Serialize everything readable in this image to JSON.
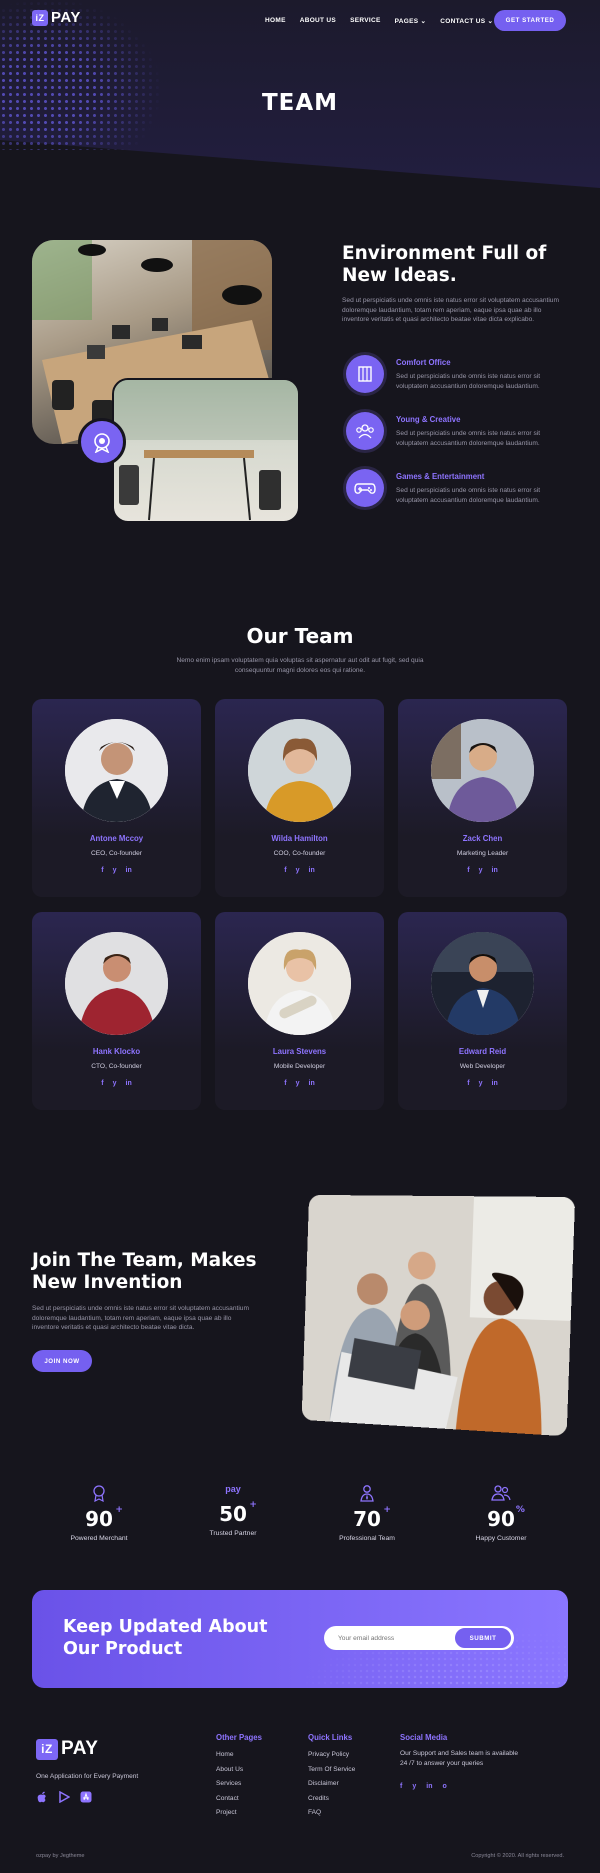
{
  "brand": {
    "logo_mark": "iZ",
    "logo_text": "PAY",
    "accent": "#7a64f2"
  },
  "nav": {
    "items": [
      "HOME",
      "ABOUT US",
      "SERVICE",
      "PAGES",
      "CONTACT US"
    ],
    "active": "PAGES",
    "cta": "GET STARTED"
  },
  "hero": {
    "title": "TEAM"
  },
  "environment": {
    "title_line1": "Environment Full of",
    "title_line2": "New Ideas.",
    "desc": "Sed ut perspiciatis unde omnis iste natus error sit voluptatem accusantium doloremque laudantium, totam rem aperiam, eaque ipsa quae ab illo inventore veritatis et quasi architecto beatae vitae dicta explicabo.",
    "features": [
      {
        "title": "Comfort Office",
        "desc": "Sed ut perspiciatis unde omnis iste natus error sit voluptatem accusantium doloremque laudantium.",
        "icon": "building-icon"
      },
      {
        "title": "Young & Creative",
        "desc": "Sed ut perspiciatis unde omnis iste natus error sit voluptatem accusantium doloremque laudantium.",
        "icon": "team-icon"
      },
      {
        "title": "Games & Entertainment",
        "desc": "Sed ut perspiciatis unde omnis iste natus error sit voluptatem accusantium doloremque laudantium.",
        "icon": "gamepad-icon"
      }
    ]
  },
  "team": {
    "title": "Our Team",
    "desc_line1": "Nemo enim ipsam voluptatem quia voluptas sit aspernatur aut odit aut fugit, sed quia",
    "desc_line2": "consequuntur magni dolores eos qui ratione.",
    "members": [
      {
        "name": "Antone Mccoy",
        "role": "CEO, Co-founder"
      },
      {
        "name": "Wilda Hamilton",
        "role": "COO, Co-founder"
      },
      {
        "name": "Zack Chen",
        "role": "Marketing Leader"
      },
      {
        "name": "Hank Klocko",
        "role": "CTO, Co-founder"
      },
      {
        "name": "Laura Stevens",
        "role": "Mobile Developer"
      },
      {
        "name": "Edward Reid",
        "role": "Web Developer"
      }
    ],
    "social": [
      "f",
      "y",
      "in"
    ]
  },
  "join": {
    "title_line1": "Join The Team, Makes",
    "title_line2": "New Invention",
    "desc": "Sed ut perspiciatis unde omnis iste natus error sit voluptatem accusantium doloremque laudantium, totam rem aperiam, eaque ipsa quae ab illo inventore veritatis et quasi architecto beatae vitae dicta.",
    "cta": "JOIN NOW"
  },
  "stats": [
    {
      "value": "90",
      "suffix": "+",
      "label": "Powered Merchant",
      "icon": "badge-icon"
    },
    {
      "value": "50",
      "suffix": "+",
      "label": "Trusted Partner",
      "icon": "amazon-pay-icon"
    },
    {
      "value": "70",
      "suffix": "+",
      "label": "Professional Team",
      "icon": "person-tie-icon"
    },
    {
      "value": "90",
      "suffix": "%",
      "label": "Happy Customer",
      "icon": "users-icon"
    }
  ],
  "newsletter": {
    "title_line1": "Keep Updated About",
    "title_line2": "Our Product",
    "placeholder": "Your email address",
    "submit": "SUBMIT"
  },
  "footer": {
    "tagline": "One Application for Every Payment",
    "other_pages": {
      "title": "Other Pages",
      "links": [
        "Home",
        "About Us",
        "Services",
        "Contact",
        "Project"
      ]
    },
    "quick_links": {
      "title": "Quick Links",
      "links": [
        "Privacy Policy",
        "Term Of Service",
        "Disclaimer",
        "Credits",
        "FAQ"
      ]
    },
    "social_media": {
      "title": "Social Media",
      "text_line1": "Our Support and Sales team is available",
      "text_line2": "24 /7 to answer your queries",
      "icons": [
        "f",
        "y",
        "in",
        "o"
      ]
    },
    "credit": "ozpay by Jegtheme",
    "copyright": "Copyright © 2020. All rights reserved."
  }
}
